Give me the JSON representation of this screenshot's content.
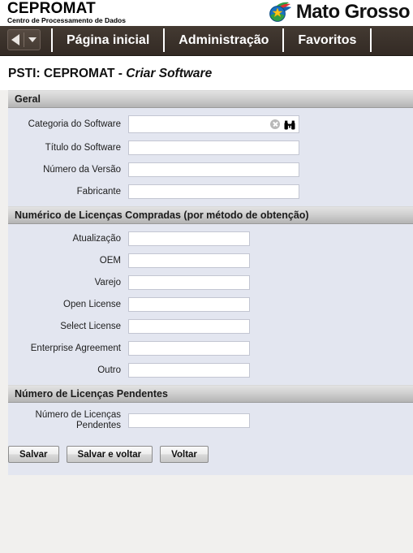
{
  "header": {
    "org_name": "CEPROMAT",
    "org_subtitle": "Centro de Processamento de Dados",
    "state_brand": "Mato Grosso",
    "logo_icon": "mato-grosso-globe-star-logo"
  },
  "nav": {
    "back_icon": "back-arrow-icon",
    "back_caret_icon": "chevron-down-icon",
    "items": [
      {
        "label": "Página inicial"
      },
      {
        "label": "Administração"
      },
      {
        "label": "Favoritos"
      }
    ]
  },
  "page": {
    "title_prefix": "PSTI: CEPROMAT - ",
    "title_emphasis": "Criar Software"
  },
  "sections": [
    {
      "title": "Geral",
      "fields": [
        {
          "label": "Categoria do Software",
          "value": "",
          "placeholder": "",
          "type": "lookup",
          "clear_icon": "clear-circle-icon",
          "search_icon": "binoculars-search-icon"
        },
        {
          "label": "Título do Software",
          "value": "",
          "placeholder": "",
          "type": "text"
        },
        {
          "label": "Número da Versão",
          "value": "",
          "placeholder": "",
          "type": "text"
        },
        {
          "label": "Fabricante",
          "value": "",
          "placeholder": "",
          "type": "text"
        }
      ]
    },
    {
      "title": "Numérico de Licenças Compradas (por método de obtenção)",
      "fields": [
        {
          "label": "Atualização",
          "value": "",
          "placeholder": "",
          "type": "text"
        },
        {
          "label": "OEM",
          "value": "",
          "placeholder": "",
          "type": "text"
        },
        {
          "label": "Varejo",
          "value": "",
          "placeholder": "",
          "type": "text"
        },
        {
          "label": "Open License",
          "value": "",
          "placeholder": "",
          "type": "text"
        },
        {
          "label": "Select License",
          "value": "",
          "placeholder": "",
          "type": "text"
        },
        {
          "label": "Enterprise Agreement",
          "value": "",
          "placeholder": "",
          "type": "text"
        },
        {
          "label": "Outro",
          "value": "",
          "placeholder": "",
          "type": "text"
        }
      ]
    },
    {
      "title": "Número de Licenças Pendentes",
      "fields": [
        {
          "label": "Número de Licenças Pendentes",
          "value": "",
          "placeholder": "",
          "type": "text"
        }
      ]
    }
  ],
  "buttons": [
    {
      "label": "Salvar"
    },
    {
      "label": "Salvar e voltar"
    },
    {
      "label": "Voltar"
    }
  ],
  "colors": {
    "nav_background": "#3b322b",
    "section_bar_top": "#e2e2e2",
    "section_bar_bottom": "#b4b4b4",
    "form_background": "#e3e6f0",
    "page_background": "#f1f0ee",
    "input_border": "#c3c6d2"
  }
}
